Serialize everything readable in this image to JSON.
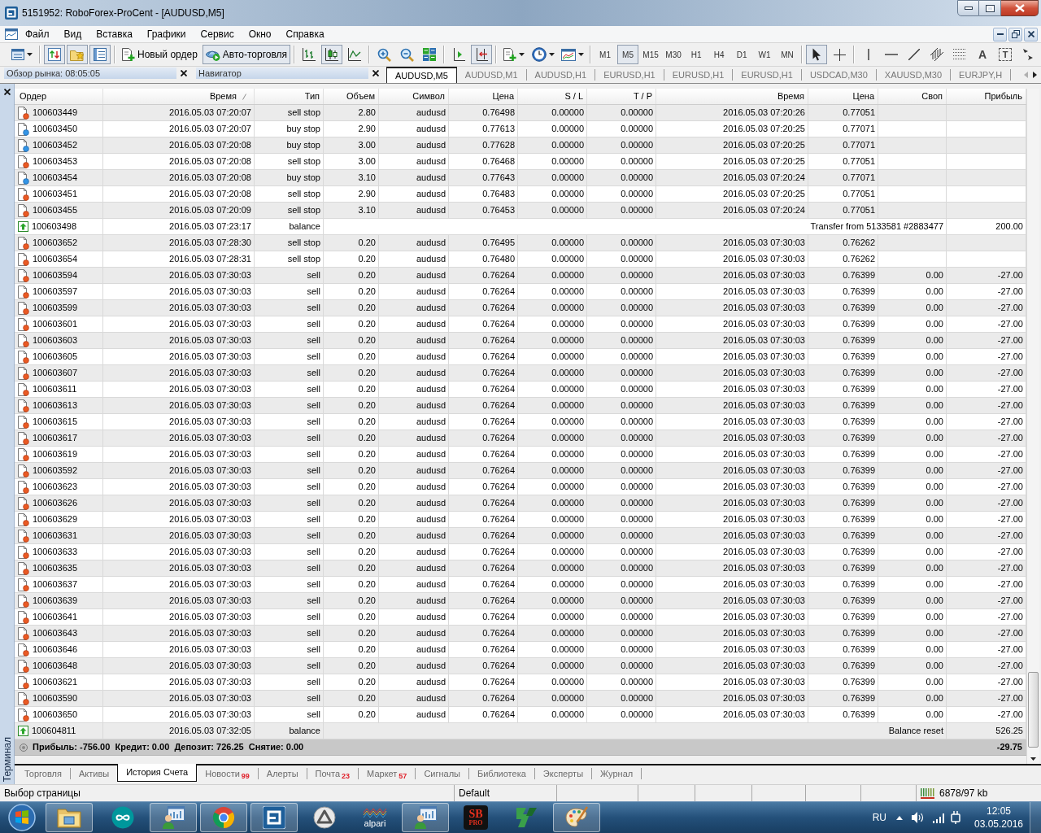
{
  "window": {
    "title": "5151952: RoboForex-ProCent - [AUDUSD,M5]"
  },
  "menu": [
    "Файл",
    "Вид",
    "Вставка",
    "Графики",
    "Сервис",
    "Окно",
    "Справка"
  ],
  "toolbar": [
    [
      {
        "kind": "menu-icon",
        "pressed": false
      }
    ],
    [
      {
        "kind": "icon",
        "pressed": true
      },
      {
        "kind": "icon",
        "pressed": true
      },
      {
        "kind": "icon",
        "pressed": true
      }
    ],
    [
      {
        "kind": "button",
        "label": "Новый ордер",
        "pressed": false
      },
      {
        "kind": "button",
        "label": "Авто-торговля",
        "pressed": true
      }
    ],
    [
      {
        "kind": "icon",
        "pressed": false
      },
      {
        "kind": "icon",
        "pressed": true
      },
      {
        "kind": "icon",
        "pressed": false
      }
    ],
    [
      {
        "kind": "icon",
        "pressed": false
      },
      {
        "kind": "icon",
        "pressed": false
      },
      {
        "kind": "icon",
        "pressed": false
      }
    ],
    [
      {
        "kind": "icon",
        "pressed": false
      },
      {
        "kind": "icon",
        "pressed": true
      }
    ],
    [
      {
        "kind": "menu-icon",
        "pressed": false
      },
      {
        "kind": "menu-icon",
        "pressed": false
      },
      {
        "kind": "menu-icon",
        "pressed": false
      }
    ],
    [
      {
        "kind": "period",
        "label": "M1",
        "selected": false
      },
      {
        "kind": "period",
        "label": "M5",
        "selected": true
      },
      {
        "kind": "period",
        "label": "M15",
        "selected": false
      },
      {
        "kind": "period",
        "label": "M30",
        "selected": false
      },
      {
        "kind": "period",
        "label": "H1",
        "selected": false
      },
      {
        "kind": "period",
        "label": "H4",
        "selected": false
      },
      {
        "kind": "period",
        "label": "D1",
        "selected": false
      },
      {
        "kind": "period",
        "label": "W1",
        "selected": false
      },
      {
        "kind": "period",
        "label": "MN",
        "selected": false
      }
    ],
    [
      {
        "kind": "icon",
        "pressed": true
      },
      {
        "kind": "icon",
        "pressed": false
      }
    ],
    [
      {
        "kind": "icon",
        "pressed": false
      },
      {
        "kind": "icon",
        "pressed": false
      },
      {
        "kind": "icon",
        "pressed": false
      },
      {
        "kind": "icon",
        "pressed": false
      },
      {
        "kind": "icon",
        "pressed": false
      },
      {
        "kind": "glyph",
        "label": "A",
        "pressed": false
      },
      {
        "kind": "framed-glyph",
        "label": "T",
        "pressed": false
      },
      {
        "kind": "icon",
        "pressed": false
      }
    ]
  ],
  "panels": [
    {
      "title": "Обзор рынка: 08:05:05"
    },
    {
      "title": "Навигатор"
    }
  ],
  "chart_tabs": {
    "tabs": [
      {
        "label": "AUDUSD,M5",
        "selected": true
      },
      {
        "label": "AUDUSD,M1",
        "selected": false
      },
      {
        "label": "AUDUSD,H1",
        "selected": false
      },
      {
        "label": "EURUSD,H1",
        "selected": false
      },
      {
        "label": "EURUSD,H1",
        "selected": false
      },
      {
        "label": "EURUSD,H1",
        "selected": false
      },
      {
        "label": "USDCAD,M30",
        "selected": false
      },
      {
        "label": "XAUUSD,M30",
        "selected": false
      },
      {
        "label": "EURJPY,H",
        "selected": false
      }
    ],
    "back_disabled": true,
    "forward_disabled": false
  },
  "terminal": {
    "title": "Терминал",
    "columns": [
      {
        "label": "Ордер",
        "sorted": false
      },
      {
        "label": "Время",
        "sorted": true
      },
      {
        "label": "Тип",
        "sorted": false
      },
      {
        "label": "Объем",
        "sorted": false
      },
      {
        "label": "Символ",
        "sorted": false
      },
      {
        "label": "Цена",
        "sorted": false
      },
      {
        "label": "S / L",
        "sorted": false
      },
      {
        "label": "T / P",
        "sorted": false
      },
      {
        "label": "Время",
        "sorted": false
      },
      {
        "label": "Цена",
        "sorted": false
      },
      {
        "label": "Своп",
        "sorted": false
      },
      {
        "label": "Прибыль",
        "sorted": false
      }
    ],
    "rows": [
      {
        "kind": "sell",
        "order": "100603449",
        "open_time": "2016.05.03 07:20:07",
        "type": "sell stop",
        "volume": "2.80",
        "symbol": "audusd",
        "open_price": "0.76498",
        "sl": "0.00000",
        "tp": "0.00000",
        "close_time": "2016.05.03 07:20:26",
        "close_price": "0.77051"
      },
      {
        "kind": "buy",
        "order": "100603450",
        "open_time": "2016.05.03 07:20:07",
        "type": "buy stop",
        "volume": "2.90",
        "symbol": "audusd",
        "open_price": "0.77613",
        "sl": "0.00000",
        "tp": "0.00000",
        "close_time": "2016.05.03 07:20:25",
        "close_price": "0.77071"
      },
      {
        "kind": "buy",
        "order": "100603452",
        "open_time": "2016.05.03 07:20:08",
        "type": "buy stop",
        "volume": "3.00",
        "symbol": "audusd",
        "open_price": "0.77628",
        "sl": "0.00000",
        "tp": "0.00000",
        "close_time": "2016.05.03 07:20:25",
        "close_price": "0.77071"
      },
      {
        "kind": "sell",
        "order": "100603453",
        "open_time": "2016.05.03 07:20:08",
        "type": "sell stop",
        "volume": "3.00",
        "symbol": "audusd",
        "open_price": "0.76468",
        "sl": "0.00000",
        "tp": "0.00000",
        "close_time": "2016.05.03 07:20:25",
        "close_price": "0.77051"
      },
      {
        "kind": "buy",
        "order": "100603454",
        "open_time": "2016.05.03 07:20:08",
        "type": "buy stop",
        "volume": "3.10",
        "symbol": "audusd",
        "open_price": "0.77643",
        "sl": "0.00000",
        "tp": "0.00000",
        "close_time": "2016.05.03 07:20:24",
        "close_price": "0.77071"
      },
      {
        "kind": "sell",
        "order": "100603451",
        "open_time": "2016.05.03 07:20:08",
        "type": "sell stop",
        "volume": "2.90",
        "symbol": "audusd",
        "open_price": "0.76483",
        "sl": "0.00000",
        "tp": "0.00000",
        "close_time": "2016.05.03 07:20:25",
        "close_price": "0.77051"
      },
      {
        "kind": "sell",
        "order": "100603455",
        "open_time": "2016.05.03 07:20:09",
        "type": "sell stop",
        "volume": "3.10",
        "symbol": "audusd",
        "open_price": "0.76453",
        "sl": "0.00000",
        "tp": "0.00000",
        "close_time": "2016.05.03 07:20:24",
        "close_price": "0.77051"
      },
      {
        "kind": "balance",
        "order": "100603498",
        "open_time": "2016.05.03 07:23:17",
        "type": "balance",
        "comment": "Transfer from 5133581 #2883477",
        "profit": "200.00"
      },
      {
        "kind": "sell",
        "order": "100603652",
        "open_time": "2016.05.03 07:28:30",
        "type": "sell stop",
        "volume": "0.20",
        "symbol": "audusd",
        "open_price": "0.76495",
        "sl": "0.00000",
        "tp": "0.00000",
        "close_time": "2016.05.03 07:30:03",
        "close_price": "0.76262"
      },
      {
        "kind": "sell",
        "order": "100603654",
        "open_time": "2016.05.03 07:28:31",
        "type": "sell stop",
        "volume": "0.20",
        "symbol": "audusd",
        "open_price": "0.76480",
        "sl": "0.00000",
        "tp": "0.00000",
        "close_time": "2016.05.03 07:30:03",
        "close_price": "0.76262"
      },
      {
        "kind": "sell",
        "order": "100603594",
        "open_time": "2016.05.03 07:30:03",
        "type": "sell",
        "volume": "0.20",
        "symbol": "audusd",
        "open_price": "0.76264",
        "sl": "0.00000",
        "tp": "0.00000",
        "close_time": "2016.05.03 07:30:03",
        "close_price": "0.76399",
        "swap": "0.00",
        "profit": "-27.00"
      },
      {
        "kind": "sell",
        "order": "100603597",
        "open_time": "2016.05.03 07:30:03",
        "type": "sell",
        "volume": "0.20",
        "symbol": "audusd",
        "open_price": "0.76264",
        "sl": "0.00000",
        "tp": "0.00000",
        "close_time": "2016.05.03 07:30:03",
        "close_price": "0.76399",
        "swap": "0.00",
        "profit": "-27.00"
      },
      {
        "kind": "sell",
        "order": "100603599",
        "open_time": "2016.05.03 07:30:03",
        "type": "sell",
        "volume": "0.20",
        "symbol": "audusd",
        "open_price": "0.76264",
        "sl": "0.00000",
        "tp": "0.00000",
        "close_time": "2016.05.03 07:30:03",
        "close_price": "0.76399",
        "swap": "0.00",
        "profit": "-27.00"
      },
      {
        "kind": "sell",
        "order": "100603601",
        "open_time": "2016.05.03 07:30:03",
        "type": "sell",
        "volume": "0.20",
        "symbol": "audusd",
        "open_price": "0.76264",
        "sl": "0.00000",
        "tp": "0.00000",
        "close_time": "2016.05.03 07:30:03",
        "close_price": "0.76399",
        "swap": "0.00",
        "profit": "-27.00"
      },
      {
        "kind": "sell",
        "order": "100603603",
        "open_time": "2016.05.03 07:30:03",
        "type": "sell",
        "volume": "0.20",
        "symbol": "audusd",
        "open_price": "0.76264",
        "sl": "0.00000",
        "tp": "0.00000",
        "close_time": "2016.05.03 07:30:03",
        "close_price": "0.76399",
        "swap": "0.00",
        "profit": "-27.00"
      },
      {
        "kind": "sell",
        "order": "100603605",
        "open_time": "2016.05.03 07:30:03",
        "type": "sell",
        "volume": "0.20",
        "symbol": "audusd",
        "open_price": "0.76264",
        "sl": "0.00000",
        "tp": "0.00000",
        "close_time": "2016.05.03 07:30:03",
        "close_price": "0.76399",
        "swap": "0.00",
        "profit": "-27.00"
      },
      {
        "kind": "sell",
        "order": "100603607",
        "open_time": "2016.05.03 07:30:03",
        "type": "sell",
        "volume": "0.20",
        "symbol": "audusd",
        "open_price": "0.76264",
        "sl": "0.00000",
        "tp": "0.00000",
        "close_time": "2016.05.03 07:30:03",
        "close_price": "0.76399",
        "swap": "0.00",
        "profit": "-27.00"
      },
      {
        "kind": "sell",
        "order": "100603611",
        "open_time": "2016.05.03 07:30:03",
        "type": "sell",
        "volume": "0.20",
        "symbol": "audusd",
        "open_price": "0.76264",
        "sl": "0.00000",
        "tp": "0.00000",
        "close_time": "2016.05.03 07:30:03",
        "close_price": "0.76399",
        "swap": "0.00",
        "profit": "-27.00"
      },
      {
        "kind": "sell",
        "order": "100603613",
        "open_time": "2016.05.03 07:30:03",
        "type": "sell",
        "volume": "0.20",
        "symbol": "audusd",
        "open_price": "0.76264",
        "sl": "0.00000",
        "tp": "0.00000",
        "close_time": "2016.05.03 07:30:03",
        "close_price": "0.76399",
        "swap": "0.00",
        "profit": "-27.00"
      },
      {
        "kind": "sell",
        "order": "100603615",
        "open_time": "2016.05.03 07:30:03",
        "type": "sell",
        "volume": "0.20",
        "symbol": "audusd",
        "open_price": "0.76264",
        "sl": "0.00000",
        "tp": "0.00000",
        "close_time": "2016.05.03 07:30:03",
        "close_price": "0.76399",
        "swap": "0.00",
        "profit": "-27.00"
      },
      {
        "kind": "sell",
        "order": "100603617",
        "open_time": "2016.05.03 07:30:03",
        "type": "sell",
        "volume": "0.20",
        "symbol": "audusd",
        "open_price": "0.76264",
        "sl": "0.00000",
        "tp": "0.00000",
        "close_time": "2016.05.03 07:30:03",
        "close_price": "0.76399",
        "swap": "0.00",
        "profit": "-27.00"
      },
      {
        "kind": "sell",
        "order": "100603619",
        "open_time": "2016.05.03 07:30:03",
        "type": "sell",
        "volume": "0.20",
        "symbol": "audusd",
        "open_price": "0.76264",
        "sl": "0.00000",
        "tp": "0.00000",
        "close_time": "2016.05.03 07:30:03",
        "close_price": "0.76399",
        "swap": "0.00",
        "profit": "-27.00"
      },
      {
        "kind": "sell",
        "order": "100603592",
        "open_time": "2016.05.03 07:30:03",
        "type": "sell",
        "volume": "0.20",
        "symbol": "audusd",
        "open_price": "0.76264",
        "sl": "0.00000",
        "tp": "0.00000",
        "close_time": "2016.05.03 07:30:03",
        "close_price": "0.76399",
        "swap": "0.00",
        "profit": "-27.00"
      },
      {
        "kind": "sell",
        "order": "100603623",
        "open_time": "2016.05.03 07:30:03",
        "type": "sell",
        "volume": "0.20",
        "symbol": "audusd",
        "open_price": "0.76264",
        "sl": "0.00000",
        "tp": "0.00000",
        "close_time": "2016.05.03 07:30:03",
        "close_price": "0.76399",
        "swap": "0.00",
        "profit": "-27.00"
      },
      {
        "kind": "sell",
        "order": "100603626",
        "open_time": "2016.05.03 07:30:03",
        "type": "sell",
        "volume": "0.20",
        "symbol": "audusd",
        "open_price": "0.76264",
        "sl": "0.00000",
        "tp": "0.00000",
        "close_time": "2016.05.03 07:30:03",
        "close_price": "0.76399",
        "swap": "0.00",
        "profit": "-27.00"
      },
      {
        "kind": "sell",
        "order": "100603629",
        "open_time": "2016.05.03 07:30:03",
        "type": "sell",
        "volume": "0.20",
        "symbol": "audusd",
        "open_price": "0.76264",
        "sl": "0.00000",
        "tp": "0.00000",
        "close_time": "2016.05.03 07:30:03",
        "close_price": "0.76399",
        "swap": "0.00",
        "profit": "-27.00"
      },
      {
        "kind": "sell",
        "order": "100603631",
        "open_time": "2016.05.03 07:30:03",
        "type": "sell",
        "volume": "0.20",
        "symbol": "audusd",
        "open_price": "0.76264",
        "sl": "0.00000",
        "tp": "0.00000",
        "close_time": "2016.05.03 07:30:03",
        "close_price": "0.76399",
        "swap": "0.00",
        "profit": "-27.00"
      },
      {
        "kind": "sell",
        "order": "100603633",
        "open_time": "2016.05.03 07:30:03",
        "type": "sell",
        "volume": "0.20",
        "symbol": "audusd",
        "open_price": "0.76264",
        "sl": "0.00000",
        "tp": "0.00000",
        "close_time": "2016.05.03 07:30:03",
        "close_price": "0.76399",
        "swap": "0.00",
        "profit": "-27.00"
      },
      {
        "kind": "sell",
        "order": "100603635",
        "open_time": "2016.05.03 07:30:03",
        "type": "sell",
        "volume": "0.20",
        "symbol": "audusd",
        "open_price": "0.76264",
        "sl": "0.00000",
        "tp": "0.00000",
        "close_time": "2016.05.03 07:30:03",
        "close_price": "0.76399",
        "swap": "0.00",
        "profit": "-27.00"
      },
      {
        "kind": "sell",
        "order": "100603637",
        "open_time": "2016.05.03 07:30:03",
        "type": "sell",
        "volume": "0.20",
        "symbol": "audusd",
        "open_price": "0.76264",
        "sl": "0.00000",
        "tp": "0.00000",
        "close_time": "2016.05.03 07:30:03",
        "close_price": "0.76399",
        "swap": "0.00",
        "profit": "-27.00"
      },
      {
        "kind": "sell",
        "order": "100603639",
        "open_time": "2016.05.03 07:30:03",
        "type": "sell",
        "volume": "0.20",
        "symbol": "audusd",
        "open_price": "0.76264",
        "sl": "0.00000",
        "tp": "0.00000",
        "close_time": "2016.05.03 07:30:03",
        "close_price": "0.76399",
        "swap": "0.00",
        "profit": "-27.00"
      },
      {
        "kind": "sell",
        "order": "100603641",
        "open_time": "2016.05.03 07:30:03",
        "type": "sell",
        "volume": "0.20",
        "symbol": "audusd",
        "open_price": "0.76264",
        "sl": "0.00000",
        "tp": "0.00000",
        "close_time": "2016.05.03 07:30:03",
        "close_price": "0.76399",
        "swap": "0.00",
        "profit": "-27.00"
      },
      {
        "kind": "sell",
        "order": "100603643",
        "open_time": "2016.05.03 07:30:03",
        "type": "sell",
        "volume": "0.20",
        "symbol": "audusd",
        "open_price": "0.76264",
        "sl": "0.00000",
        "tp": "0.00000",
        "close_time": "2016.05.03 07:30:03",
        "close_price": "0.76399",
        "swap": "0.00",
        "profit": "-27.00"
      },
      {
        "kind": "sell",
        "order": "100603646",
        "open_time": "2016.05.03 07:30:03",
        "type": "sell",
        "volume": "0.20",
        "symbol": "audusd",
        "open_price": "0.76264",
        "sl": "0.00000",
        "tp": "0.00000",
        "close_time": "2016.05.03 07:30:03",
        "close_price": "0.76399",
        "swap": "0.00",
        "profit": "-27.00"
      },
      {
        "kind": "sell",
        "order": "100603648",
        "open_time": "2016.05.03 07:30:03",
        "type": "sell",
        "volume": "0.20",
        "symbol": "audusd",
        "open_price": "0.76264",
        "sl": "0.00000",
        "tp": "0.00000",
        "close_time": "2016.05.03 07:30:03",
        "close_price": "0.76399",
        "swap": "0.00",
        "profit": "-27.00"
      },
      {
        "kind": "sell",
        "order": "100603621",
        "open_time": "2016.05.03 07:30:03",
        "type": "sell",
        "volume": "0.20",
        "symbol": "audusd",
        "open_price": "0.76264",
        "sl": "0.00000",
        "tp": "0.00000",
        "close_time": "2016.05.03 07:30:03",
        "close_price": "0.76399",
        "swap": "0.00",
        "profit": "-27.00"
      },
      {
        "kind": "sell",
        "order": "100603590",
        "open_time": "2016.05.03 07:30:03",
        "type": "sell",
        "volume": "0.20",
        "symbol": "audusd",
        "open_price": "0.76264",
        "sl": "0.00000",
        "tp": "0.00000",
        "close_time": "2016.05.03 07:30:03",
        "close_price": "0.76399",
        "swap": "0.00",
        "profit": "-27.00"
      },
      {
        "kind": "sell",
        "order": "100603650",
        "open_time": "2016.05.03 07:30:03",
        "type": "sell",
        "volume": "0.20",
        "symbol": "audusd",
        "open_price": "0.76264",
        "sl": "0.00000",
        "tp": "0.00000",
        "close_time": "2016.05.03 07:30:03",
        "close_price": "0.76399",
        "swap": "0.00",
        "profit": "-27.00"
      },
      {
        "kind": "balance",
        "order": "100604811",
        "open_time": "2016.05.03 07:32:05",
        "type": "balance",
        "comment": "Balance reset",
        "profit": "526.25"
      }
    ],
    "summary": {
      "text": "Прибыль: -756.00  Кредит: 0.00  Депозит: 726.25  Снятие: 0.00",
      "total": "-29.75"
    },
    "tabs": [
      {
        "label": "Торговля",
        "selected": false
      },
      {
        "label": "Активы",
        "selected": false
      },
      {
        "label": "История Счета",
        "selected": true
      },
      {
        "label": "Новости",
        "badge": "99",
        "selected": false
      },
      {
        "label": "Алерты",
        "selected": false
      },
      {
        "label": "Почта",
        "badge": "23",
        "selected": false
      },
      {
        "label": "Маркет",
        "badge": "57",
        "selected": false
      },
      {
        "label": "Сигналы",
        "selected": false
      },
      {
        "label": "Библиотека",
        "selected": false
      },
      {
        "label": "Эксперты",
        "selected": false
      },
      {
        "label": "Журнал",
        "selected": false
      }
    ]
  },
  "status_bar": {
    "hint": "Выбор страницы",
    "profile": "Default",
    "traffic": "6878/97 kb"
  },
  "taskbar": {
    "apps": [
      {
        "running": true
      },
      {
        "running": false
      },
      {
        "running": true
      },
      {
        "running": true
      },
      {
        "running": true
      },
      {
        "running": false
      },
      {
        "running": false,
        "label": "alpari"
      },
      {
        "running": true
      },
      {
        "running": false,
        "lines": [
          "SB",
          "PRO"
        ]
      },
      {
        "running": false
      },
      {
        "running": true
      }
    ],
    "language": "RU",
    "time": "12:05",
    "date": "03.05.2016"
  }
}
